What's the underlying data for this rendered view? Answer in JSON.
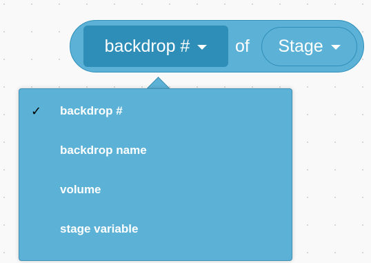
{
  "block": {
    "property_dropdown": {
      "selected": "backdrop #",
      "icon": "caret-down-icon"
    },
    "of_label": "of",
    "target_dropdown": {
      "selected": "Stage",
      "icon": "caret-down-icon"
    }
  },
  "menu": {
    "check_glyph": "✓",
    "items": [
      {
        "label": "backdrop #",
        "checked": true
      },
      {
        "label": "backdrop name",
        "checked": false
      },
      {
        "label": "volume",
        "checked": false
      },
      {
        "label": "stage variable",
        "checked": false
      }
    ]
  },
  "colors": {
    "block_fill": "#5cb1d6",
    "block_border": "#2e8eb8",
    "selected_field": "#2e8eb8",
    "text": "#ffffff",
    "canvas": "#f9f9f9"
  }
}
